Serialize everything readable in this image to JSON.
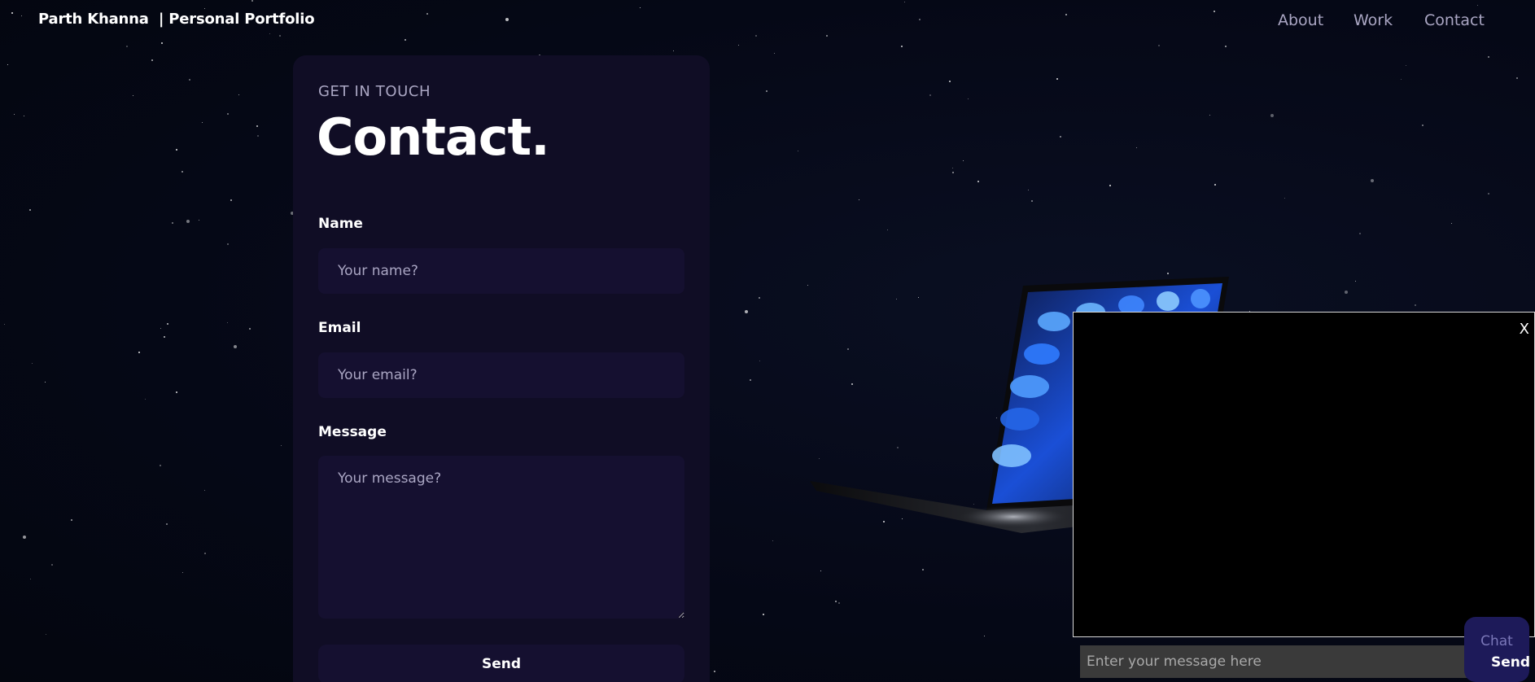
{
  "navbar": {
    "brand": "Parth Khanna  | Personal Portfolio",
    "links": [
      "About",
      "Work",
      "Contact"
    ]
  },
  "contact": {
    "subtitle": "GET IN TOUCH",
    "heading": "Contact.",
    "name_label": "Name",
    "name_placeholder": "Your name?",
    "email_label": "Email",
    "email_placeholder": "Your email?",
    "message_label": "Message",
    "message_placeholder": "Your message?",
    "send_label": "Send"
  },
  "chat": {
    "close_label": "X",
    "input_placeholder": "Enter your message here",
    "toggle_label": "Chat",
    "send_label": "Send"
  },
  "colors": {
    "background": "#050816",
    "card": "#100d25",
    "input": "#151030",
    "secondary_text": "#aaa6c3",
    "chat_toggle": "#1d1a59"
  },
  "icons": {
    "laptop": "laptop-3d-model"
  }
}
